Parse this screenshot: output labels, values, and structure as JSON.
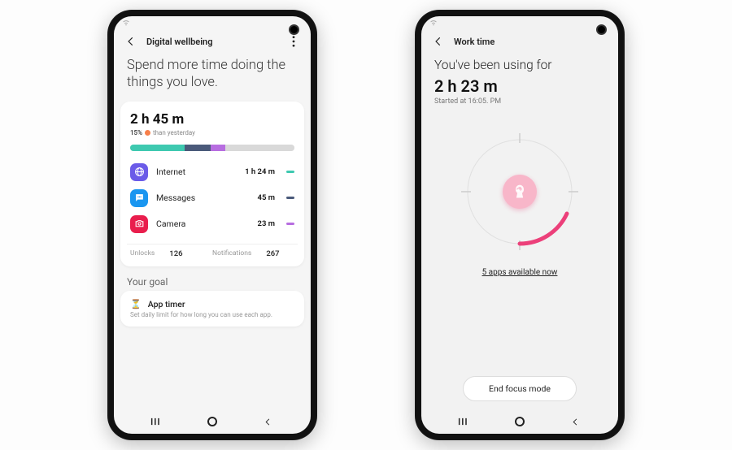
{
  "left": {
    "title": "Digital wellbeing",
    "hero": "Spend more time doing the things you love.",
    "total_time": "2 h 45 m",
    "delta_pct": "15%",
    "delta_text": "than yesterday",
    "segments": [
      {
        "color": "#3ec9b0",
        "pct": 33
      },
      {
        "color": "#4a5a7a",
        "pct": 16
      },
      {
        "color": "#b76de0",
        "pct": 9
      },
      {
        "color": "#d9d9d9",
        "pct": 42
      }
    ],
    "apps": [
      {
        "name": "Internet",
        "time": "1 h 24 m",
        "dot": "#3ec9b0"
      },
      {
        "name": "Messages",
        "time": "45 m",
        "dot": "#4a5a7a"
      },
      {
        "name": "Camera",
        "time": "23 m",
        "dot": "#b76de0"
      }
    ],
    "unlocks_label": "Unlocks",
    "unlocks": "126",
    "notif_label": "Notifications",
    "notif": "267",
    "goal_header": "Your goal",
    "goal_title": "App timer",
    "goal_desc": "Set daily limit for how long you can use each app."
  },
  "right": {
    "title": "Work time",
    "hero": "You've been using for",
    "time": "2 h 23 m",
    "started": "Started at 16:05. PM",
    "available": "5 apps available now",
    "end": "End focus mode"
  }
}
